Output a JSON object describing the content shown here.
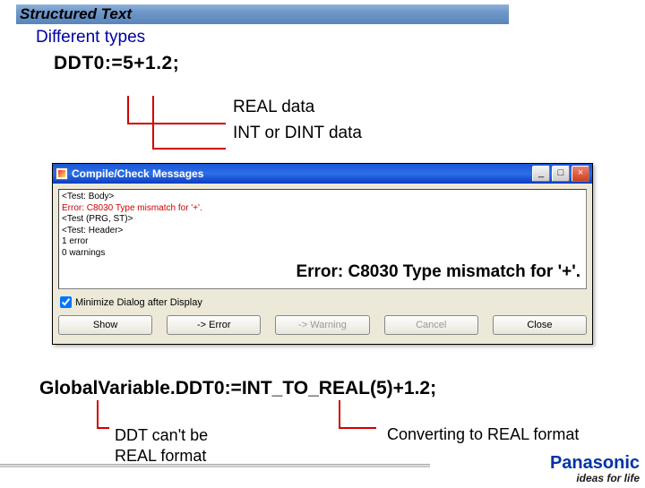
{
  "header": {
    "title": "Structured Text"
  },
  "subtitle": "Different types",
  "code1": {
    "a": "DDT0:=5",
    "b": "+",
    "c": "1.2;"
  },
  "labels": {
    "real": "REAL data",
    "int": "INT or DINT data"
  },
  "dialog": {
    "title": "Compile/Check Messages",
    "winbtns": {
      "min": "_",
      "max": "□",
      "close": "×"
    },
    "msgs": {
      "l1": "<Test: Body>",
      "l2": "Error: C8030 Type mismatch for '+'.",
      "l3": "<Test (PRG, ST)>",
      "l4": "<Test: Header>",
      "l5": "1 error",
      "l6": "0 warnings"
    },
    "big_error": "Error: C8030 Type mismatch for '+'.",
    "checkbox": "Minimize Dialog after Display",
    "buttons": {
      "show": "Show",
      "err": "-> Error",
      "warn": "-> Warning",
      "cancel": "Cancel",
      "close": "Close"
    }
  },
  "code2": {
    "pre": "GlobalVariable.DDT0:=",
    "fn": "INT_TO_REAL(5)",
    "post": "+1.2;"
  },
  "notes": {
    "ddt": "DDT can't be\nREAL format",
    "conv": "Converting to REAL format"
  },
  "brand": {
    "name": "Panasonic",
    "tagline": "ideas for life"
  }
}
